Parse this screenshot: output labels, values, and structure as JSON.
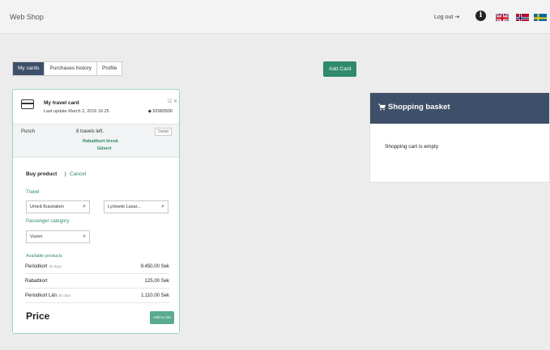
{
  "header": {
    "brand": "Web Shop",
    "logout_label": "Log out ⇥",
    "info_glyph": "i",
    "info_icon": "info-circle-icon",
    "languages": [
      {
        "name": "uk-flag-icon"
      },
      {
        "name": "norway-flag-icon"
      },
      {
        "name": "sweden-flag-icon"
      }
    ]
  },
  "tabs": [
    {
      "label": "My cards",
      "active": true
    },
    {
      "label": "Purchases history",
      "active": false
    },
    {
      "label": "Profile",
      "active": false
    }
  ],
  "add_card_label": "Add Card",
  "card": {
    "name": "My travel card",
    "updated": "Last update March 2, 2016 16:25",
    "actions": "☑ ✕",
    "number": "◆ 92983500",
    "punch_label": "Punch",
    "punch_left": "8 travels left.",
    "punch_badge": "Detail",
    "punch_link1": "Rabattkort tiresä",
    "punch_link2": "Gävert",
    "buy_title": "Buy product",
    "buy_sep": "|",
    "cancel_label": "Cancel",
    "travel_label": "Travel",
    "from_value": "Umeå Busstation",
    "to_value": "Lycksele Lasar...",
    "passenger_label": "Passenger category",
    "passenger_value": "Vuxen",
    "products_label": "Available products",
    "products": [
      {
        "name": "Periodkort",
        "note": "30 days",
        "price": "9.450,00 Sek"
      },
      {
        "name": "Rabattkort",
        "note": "",
        "price": "125,00 Sek"
      },
      {
        "name": "Periodkort Län",
        "note": "30 days",
        "price": "1.110,00 Sek"
      }
    ],
    "price_label": "Price",
    "add_to_cart_label": "Add to cart"
  },
  "basket": {
    "title": "Shopping basket",
    "empty_text": "Shopping cart is empty"
  },
  "colors": {
    "accent": "#2e8a6a",
    "navy": "#3e4f69"
  }
}
